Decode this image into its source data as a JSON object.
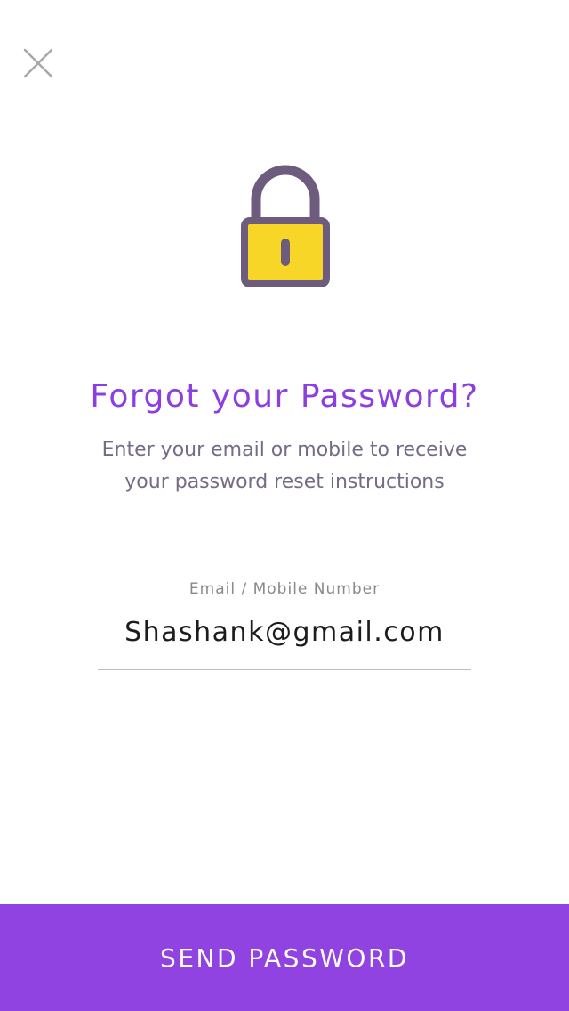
{
  "header": {
    "close_icon": "close-icon"
  },
  "hero": {
    "icon": "padlock-icon",
    "colors": {
      "lock_body": "#f8d628",
      "lock_outline": "#6d5c7d"
    }
  },
  "content": {
    "title": "Forgot your Password?",
    "subtitle_line1": "Enter your email or mobile to receive",
    "subtitle_line2": "your password reset instructions"
  },
  "form": {
    "label": "Email / Mobile Number",
    "value": "Shashank@gmail.com"
  },
  "footer": {
    "button_label": "SEND PASSWORD",
    "button_color": "#9043e0"
  }
}
